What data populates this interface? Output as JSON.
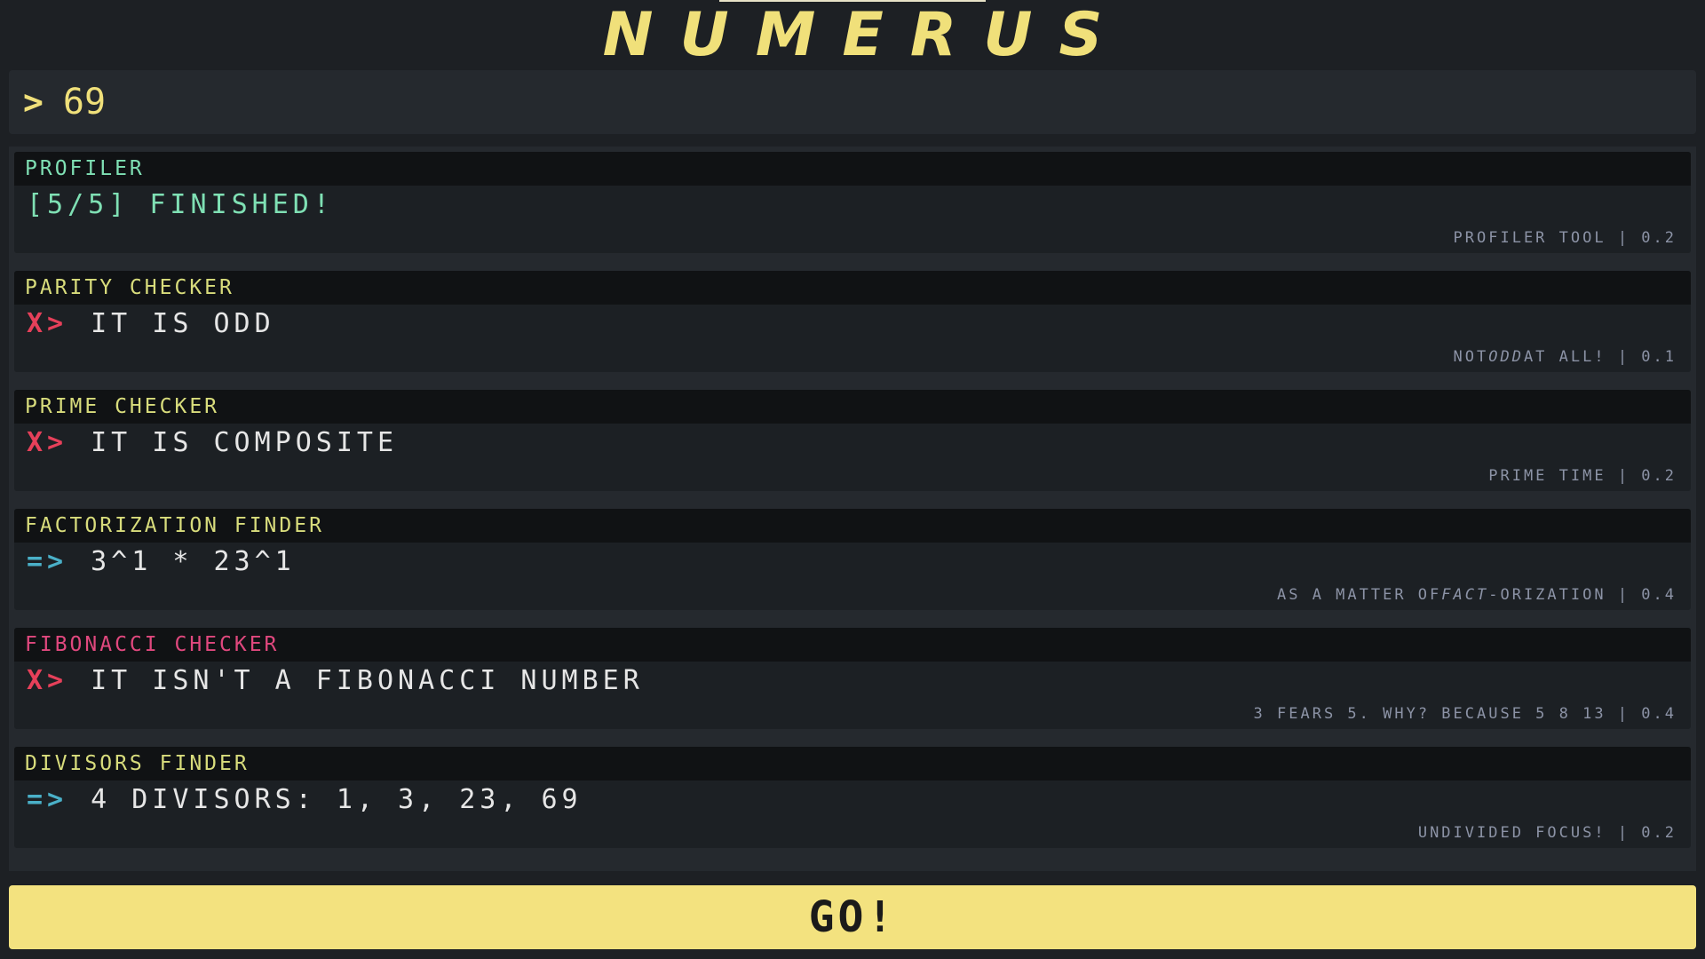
{
  "app": {
    "title": "NUMERUS"
  },
  "input": {
    "prompt": ">",
    "value": "69"
  },
  "cards": [
    {
      "title": "PROFILER",
      "marker": "",
      "result": "[5/5] FINISHED!",
      "foot": [
        "PROFILER TOOL | 0.2"
      ]
    },
    {
      "title": "PARITY CHECKER",
      "marker": "X>",
      "result": "IT IS ODD",
      "foot": [
        "NOT ",
        "ODD",
        " AT ALL! | 0.1"
      ]
    },
    {
      "title": "PRIME CHECKER",
      "marker": "X>",
      "result": "IT IS COMPOSITE",
      "foot": [
        "PRIME TIME | 0.2"
      ]
    },
    {
      "title": "FACTORIZATION FINDER",
      "marker": "=>",
      "result": "3^1 * 23^1",
      "foot": [
        "AS A MATTER OF ",
        "FACT",
        "-ORIZATION | 0.4"
      ]
    },
    {
      "title": "FIBONACCI CHECKER",
      "marker": "X>",
      "result": "IT ISN'T A FIBONACCI NUMBER",
      "foot": [
        "3 FEARS 5. WHY? BECAUSE 5 8 13 | 0.4"
      ]
    },
    {
      "title": "DIVISORS FINDER",
      "marker": "=>",
      "result": "4 DIVISORS: 1, 3, 23, 69",
      "foot": [
        "UNDIVIDED FOCUS! | 0.2"
      ]
    }
  ],
  "go_button": {
    "label": "GO!"
  },
  "colors": {
    "accent": "#f3e27f",
    "background": "#1d2024",
    "error": "#e6405a",
    "success": "#7fe0b4",
    "info": "#4ab0c8"
  }
}
